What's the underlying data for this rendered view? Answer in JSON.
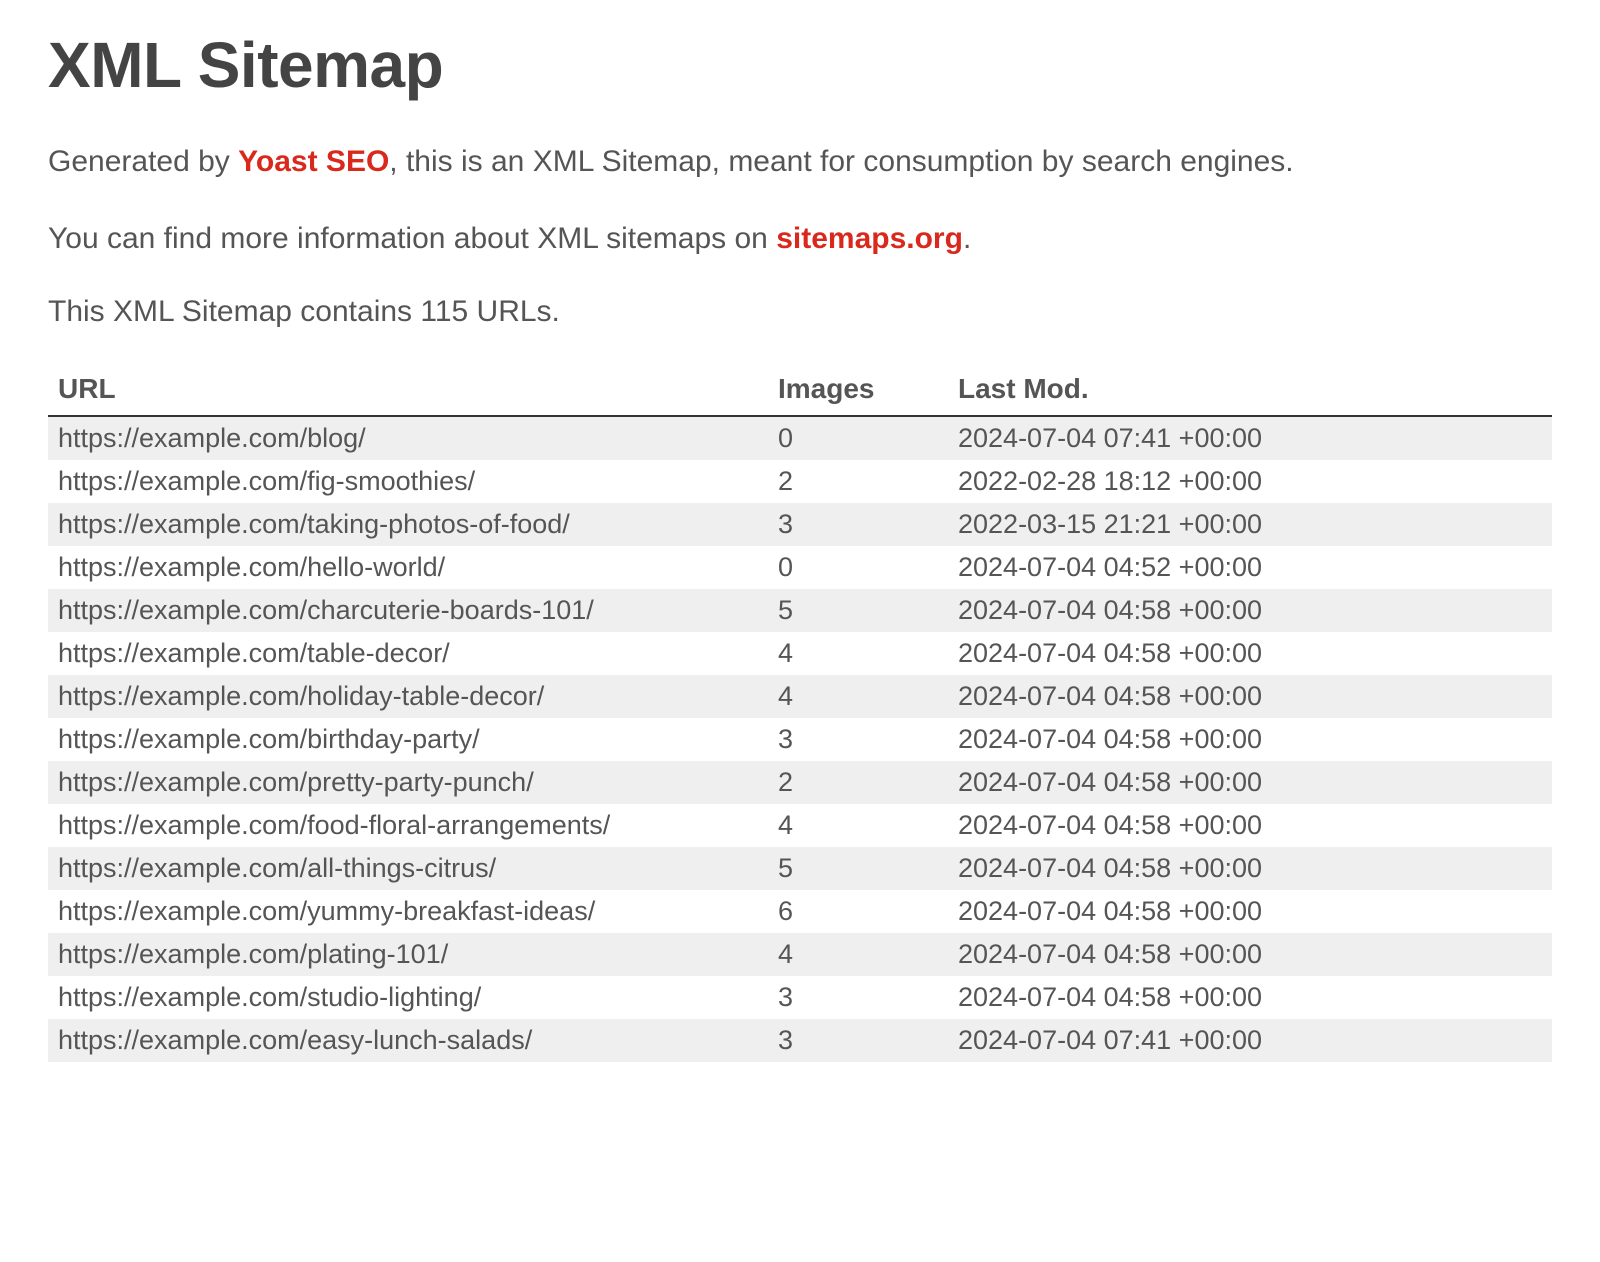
{
  "header": {
    "title": "XML Sitemap"
  },
  "intro": {
    "prefix": "Generated by ",
    "brand": "Yoast SEO",
    "suffix": ", this is an XML Sitemap, meant for consumption by search engines."
  },
  "moreinfo": {
    "prefix": "You can find more information about XML sitemaps on ",
    "linktext": "sitemaps.org",
    "suffix": "."
  },
  "count_line": "This XML Sitemap contains 115 URLs.",
  "table": {
    "headers": {
      "url": "URL",
      "images": "Images",
      "lastmod": "Last Mod."
    },
    "rows": [
      {
        "url": "https://example.com/blog/",
        "images": "0",
        "lastmod": "2024-07-04 07:41 +00:00"
      },
      {
        "url": "https://example.com/fig-smoothies/",
        "images": "2",
        "lastmod": "2022-02-28 18:12 +00:00"
      },
      {
        "url": "https://example.com/taking-photos-of-food/",
        "images": "3",
        "lastmod": "2022-03-15 21:21 +00:00"
      },
      {
        "url": "https://example.com/hello-world/",
        "images": "0",
        "lastmod": "2024-07-04 04:52 +00:00"
      },
      {
        "url": "https://example.com/charcuterie-boards-101/",
        "images": "5",
        "lastmod": "2024-07-04 04:58 +00:00"
      },
      {
        "url": "https://example.com/table-decor/",
        "images": "4",
        "lastmod": "2024-07-04 04:58 +00:00"
      },
      {
        "url": "https://example.com/holiday-table-decor/",
        "images": "4",
        "lastmod": "2024-07-04 04:58 +00:00"
      },
      {
        "url": "https://example.com/birthday-party/",
        "images": "3",
        "lastmod": "2024-07-04 04:58 +00:00"
      },
      {
        "url": "https://example.com/pretty-party-punch/",
        "images": "2",
        "lastmod": "2024-07-04 04:58 +00:00"
      },
      {
        "url": "https://example.com/food-floral-arrangements/",
        "images": "4",
        "lastmod": "2024-07-04 04:58 +00:00"
      },
      {
        "url": "https://example.com/all-things-citrus/",
        "images": "5",
        "lastmod": "2024-07-04 04:58 +00:00"
      },
      {
        "url": "https://example.com/yummy-breakfast-ideas/",
        "images": "6",
        "lastmod": "2024-07-04 04:58 +00:00"
      },
      {
        "url": "https://example.com/plating-101/",
        "images": "4",
        "lastmod": "2024-07-04 04:58 +00:00"
      },
      {
        "url": "https://example.com/studio-lighting/",
        "images": "3",
        "lastmod": "2024-07-04 04:58 +00:00"
      },
      {
        "url": "https://example.com/easy-lunch-salads/",
        "images": "3",
        "lastmod": "2024-07-04 07:41 +00:00"
      }
    ]
  }
}
